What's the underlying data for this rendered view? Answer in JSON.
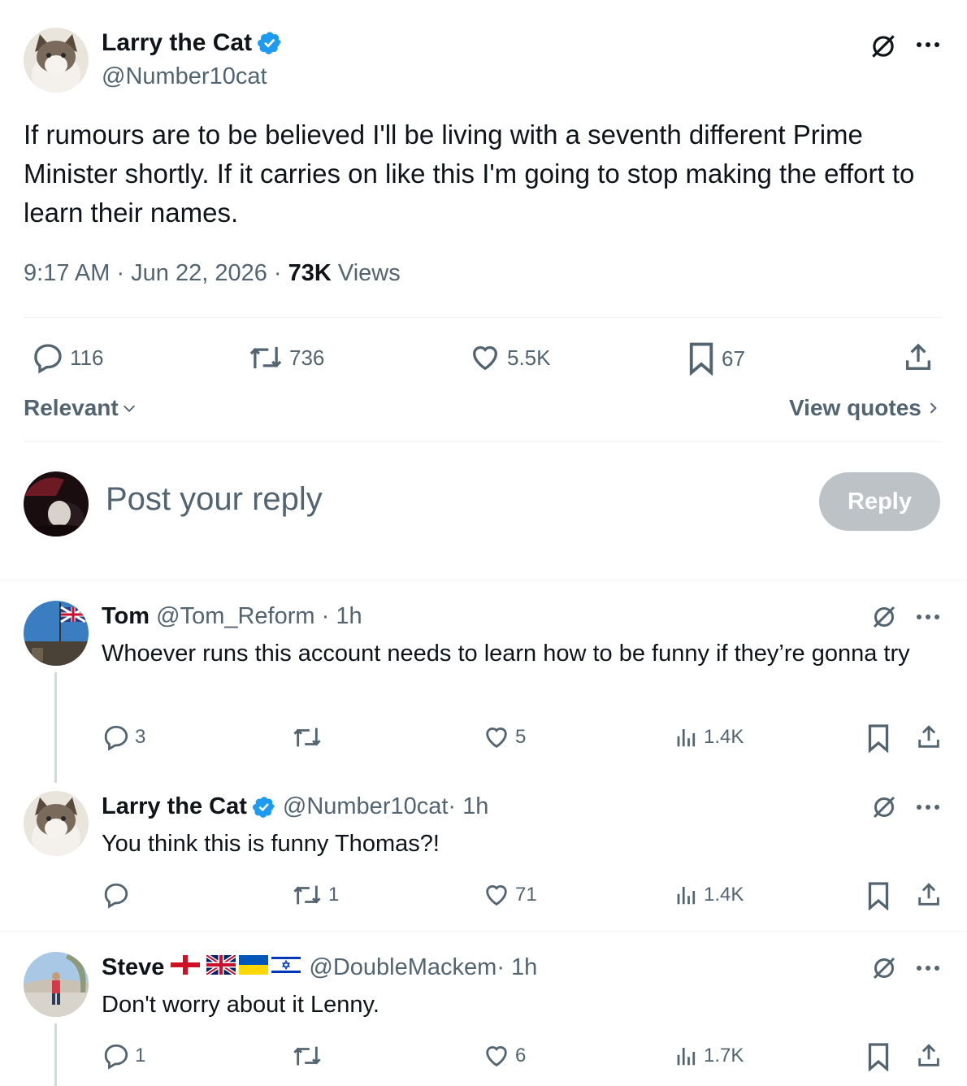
{
  "colors": {
    "verified": "#1d9bf0",
    "muted": "#536471",
    "text": "#0f1419",
    "reply_button_bg": "#bcc2c6"
  },
  "main_post": {
    "author_name": "Larry the Cat",
    "handle": "@Number10cat",
    "verified": true,
    "text": "If rumours are to be believed I'll be living with a seventh different Prime Minister shortly. If it carries on like this I'm going to stop making the effort to learn their names.",
    "time": "9:17 AM · Jun 22, 2026 · ",
    "views_count": "73K",
    "views_label": " Views",
    "stats": {
      "replies": "116",
      "reposts": "736",
      "likes": "5.5K",
      "bookmarks": "67"
    },
    "icons": [
      "grok-icon",
      "more-icon",
      "reply-icon",
      "repost-icon",
      "like-icon",
      "bookmark-icon",
      "share-icon"
    ]
  },
  "sort": {
    "label": "Relevant",
    "view_quotes": "View quotes"
  },
  "composer": {
    "placeholder": "Post your reply",
    "button": "Reply"
  },
  "replies": [
    {
      "name": "Tom",
      "handle": "@Tom_Reform",
      "time": " · 1h",
      "text": "Whoever runs this account needs to learn how to be funny if they’re gonna try",
      "replies": "3",
      "reposts": "",
      "likes": "5",
      "views": "1.4K"
    },
    {
      "name": "Larry the Cat",
      "handle": "@Number10cat",
      "time": " · 1h",
      "verified": true,
      "text": "You think this is funny Thomas?!",
      "replies": "",
      "reposts": "1",
      "likes": "71",
      "views": "1.4K"
    },
    {
      "name": "Steve",
      "flags": [
        "england-flag-icon",
        "uk-flag-icon",
        "ukraine-flag-icon",
        "israel-flag-icon"
      ],
      "handle": "@DoubleMackem",
      "time": " · 1h",
      "text": "Don't worry about it Lenny.",
      "replies": "1",
      "reposts": "",
      "likes": "6",
      "views": "1.7K"
    }
  ]
}
